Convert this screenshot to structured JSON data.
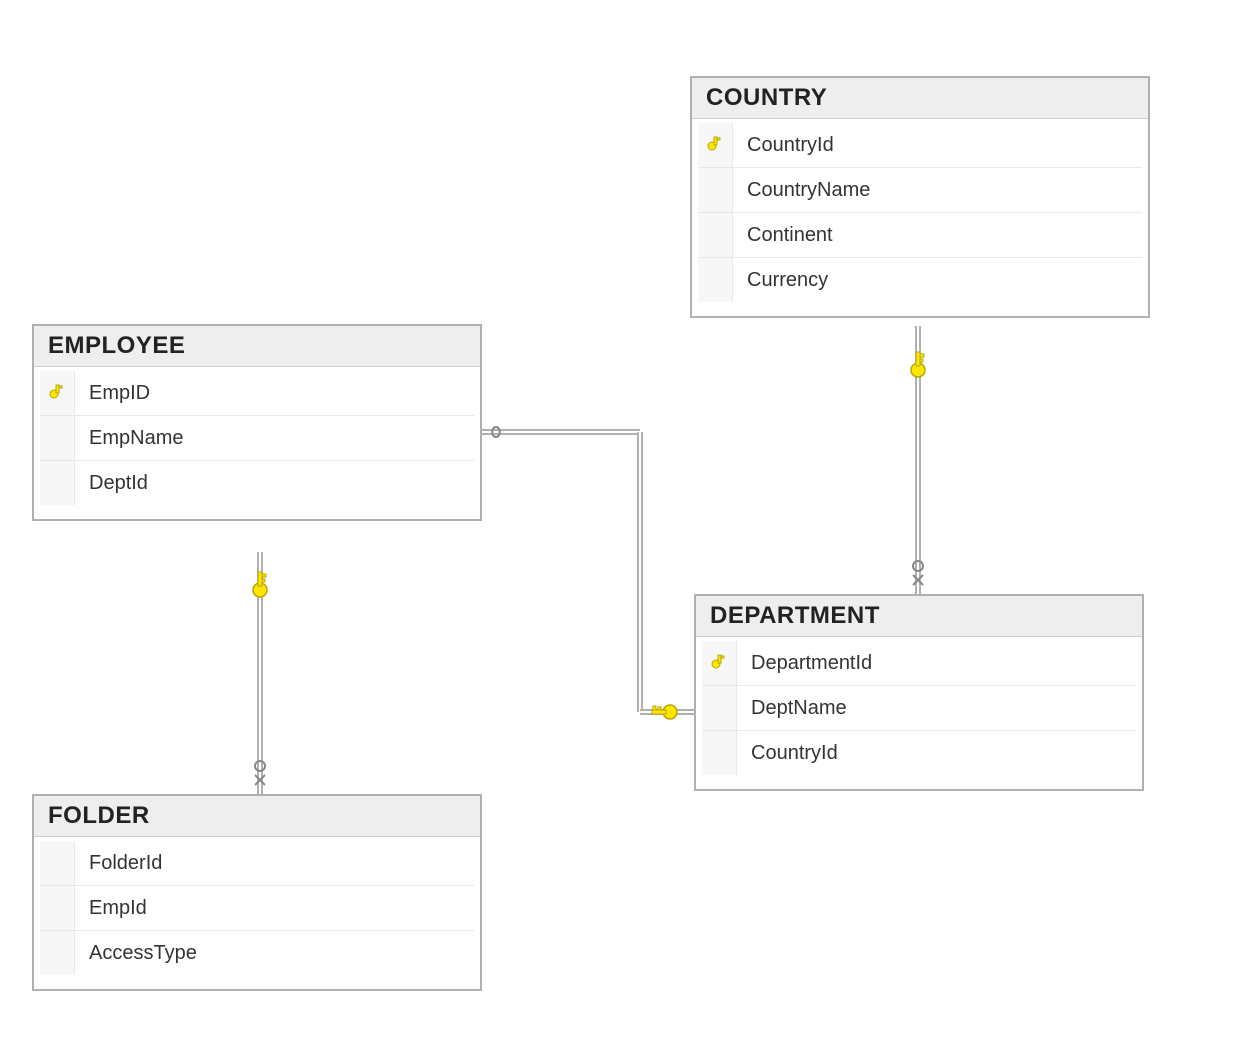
{
  "diagram": {
    "entities": {
      "country": {
        "title": "COUNTRY",
        "columns": [
          {
            "name": "CountryId",
            "pk": true
          },
          {
            "name": "CountryName",
            "pk": false
          },
          {
            "name": "Continent",
            "pk": false
          },
          {
            "name": "Currency",
            "pk": false
          }
        ]
      },
      "employee": {
        "title": "EMPLOYEE",
        "columns": [
          {
            "name": "EmpID",
            "pk": true
          },
          {
            "name": "EmpName",
            "pk": false
          },
          {
            "name": "DeptId",
            "pk": false
          }
        ]
      },
      "department": {
        "title": "DEPARTMENT",
        "columns": [
          {
            "name": "DepartmentId",
            "pk": true
          },
          {
            "name": "DeptName",
            "pk": false
          },
          {
            "name": "CountryId",
            "pk": false
          }
        ]
      },
      "folder": {
        "title": "FOLDER",
        "columns": [
          {
            "name": "FolderId",
            "pk": false
          },
          {
            "name": "EmpId",
            "pk": false
          },
          {
            "name": "AccessType",
            "pk": false
          }
        ]
      }
    },
    "relationships": [
      {
        "from": "EMPLOYEE",
        "to": "DEPARTMENT",
        "fromEnd": "many",
        "toEnd": "one-key"
      },
      {
        "from": "DEPARTMENT",
        "to": "COUNTRY",
        "fromEnd": "many",
        "toEnd": "one-key"
      },
      {
        "from": "FOLDER",
        "to": "EMPLOYEE",
        "fromEnd": "many",
        "toEnd": "one-key"
      }
    ]
  }
}
